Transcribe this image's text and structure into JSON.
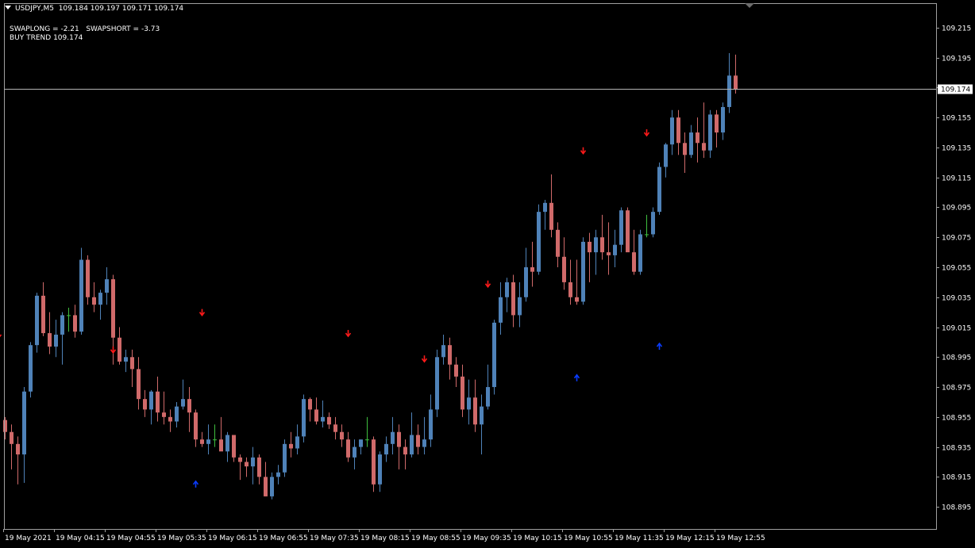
{
  "header": {
    "symbol": "USDJPY,M5",
    "ohlc": "109.184 109.197 109.171 109.174",
    "swap_text": "SWAPLONG = -2.21   SWAPSHORT = -3.73",
    "trend_text": "BUY TREND 109.174"
  },
  "colors": {
    "background": "#000000",
    "frame": "#a0a0a0",
    "bull": "#4f82b8",
    "bear": "#d06a6a",
    "doji": "#3fbf3f",
    "down_arrow": "#ff1a1a",
    "up_arrow": "#0a3cff",
    "text": "#ffffff"
  },
  "chart_data": {
    "type": "candlestick",
    "y_range": [
      108.885,
      109.225
    ],
    "yticks": [
      "109.215",
      "109.195",
      "109.175",
      "109.155",
      "109.135",
      "109.115",
      "109.095",
      "109.075",
      "109.055",
      "109.035",
      "109.015",
      "108.995",
      "108.975",
      "108.955",
      "108.935",
      "108.915",
      "108.895"
    ],
    "current_price": "109.174",
    "xticks": [
      "19 May 2021",
      "19 May 04:15",
      "19 May 04:55",
      "19 May 05:35",
      "19 May 06:15",
      "19 May 06:55",
      "19 May 07:35",
      "19 May 08:15",
      "19 May 08:55",
      "19 May 09:35",
      "19 May 10:15",
      "19 May 10:55",
      "19 May 11:35",
      "19 May 12:15",
      "19 May 12:55"
    ],
    "candles": [
      [
        108.953,
        108.955,
        108.94,
        108.945
      ],
      [
        108.945,
        108.95,
        108.92,
        108.937
      ],
      [
        108.937,
        108.942,
        108.91,
        108.93
      ],
      [
        108.93,
        108.975,
        108.911,
        108.972
      ],
      [
        108.972,
        109.005,
        108.968,
        109.003
      ],
      [
        109.003,
        109.038,
        108.998,
        109.036
      ],
      [
        109.036,
        109.045,
        109.009,
        109.011
      ],
      [
        109.011,
        109.025,
        108.997,
        109.002
      ],
      [
        109.002,
        109.02,
        108.995,
        109.01
      ],
      [
        109.01,
        109.025,
        108.99,
        109.023
      ],
      [
        109.023,
        109.028,
        109.012,
        109.023
      ],
      [
        109.023,
        109.03,
        109.008,
        109.012
      ],
      [
        109.012,
        109.068,
        109.01,
        109.06
      ],
      [
        109.06,
        109.063,
        109.03,
        109.035
      ],
      [
        109.035,
        109.045,
        109.025,
        109.03
      ],
      [
        109.03,
        109.04,
        109.02,
        109.038
      ],
      [
        109.038,
        109.055,
        109.03,
        109.047
      ],
      [
        109.047,
        109.05,
        108.99,
        109.008
      ],
      [
        109.008,
        109.015,
        108.99,
        108.992
      ],
      [
        108.992,
        109.0,
        108.985,
        108.995
      ],
      [
        108.995,
        109.0,
        108.975,
        108.987
      ],
      [
        108.987,
        108.995,
        108.96,
        108.967
      ],
      [
        108.967,
        108.973,
        108.955,
        108.96
      ],
      [
        108.96,
        108.973,
        108.95,
        108.972
      ],
      [
        108.972,
        108.982,
        108.952,
        108.958
      ],
      [
        108.958,
        108.972,
        108.95,
        108.955
      ],
      [
        108.955,
        108.96,
        108.945,
        108.952
      ],
      [
        108.952,
        108.965,
        108.948,
        108.962
      ],
      [
        108.962,
        108.98,
        108.96,
        108.967
      ],
      [
        108.967,
        108.975,
        108.945,
        108.958
      ],
      [
        108.958,
        108.96,
        108.935,
        108.94
      ],
      [
        108.94,
        108.945,
        108.935,
        108.937
      ],
      [
        108.937,
        108.95,
        108.93,
        108.94
      ],
      [
        108.94,
        108.95,
        108.935,
        108.94
      ],
      [
        108.94,
        108.955,
        108.935,
        108.932
      ],
      [
        108.932,
        108.945,
        108.925,
        108.943
      ],
      [
        108.943,
        108.943,
        108.925,
        108.928
      ],
      [
        108.928,
        108.93,
        108.913,
        108.925
      ],
      [
        108.925,
        108.928,
        108.915,
        108.922
      ],
      [
        108.922,
        108.935,
        108.91,
        108.928
      ],
      [
        108.928,
        108.93,
        108.91,
        108.915
      ],
      [
        108.915,
        108.925,
        108.902,
        108.902
      ],
      [
        108.902,
        108.918,
        108.9,
        108.915
      ],
      [
        108.915,
        108.923,
        108.91,
        108.918
      ],
      [
        108.918,
        108.94,
        108.915,
        108.937
      ],
      [
        108.937,
        108.945,
        108.928,
        108.934
      ],
      [
        108.934,
        108.95,
        108.93,
        108.942
      ],
      [
        108.942,
        108.97,
        108.938,
        108.967
      ],
      [
        108.967,
        108.968,
        108.952,
        108.96
      ],
      [
        108.96,
        108.968,
        108.95,
        108.952
      ],
      [
        108.952,
        108.966,
        108.948,
        108.955
      ],
      [
        108.955,
        108.958,
        108.947,
        108.95
      ],
      [
        108.95,
        108.955,
        108.94,
        108.945
      ],
      [
        108.945,
        108.95,
        108.935,
        108.94
      ],
      [
        108.94,
        108.945,
        108.925,
        108.928
      ],
      [
        108.928,
        108.94,
        108.92,
        108.935
      ],
      [
        108.935,
        108.94,
        108.93,
        108.94
      ],
      [
        108.94,
        108.955,
        108.935,
        108.94
      ],
      [
        108.94,
        108.942,
        108.905,
        108.91
      ],
      [
        108.91,
        108.932,
        108.905,
        108.93
      ],
      [
        108.93,
        108.942,
        108.925,
        108.937
      ],
      [
        108.937,
        108.955,
        108.93,
        108.945
      ],
      [
        108.945,
        108.95,
        108.92,
        108.935
      ],
      [
        108.935,
        108.94,
        108.92,
        108.93
      ],
      [
        108.93,
        108.958,
        108.928,
        108.943
      ],
      [
        108.943,
        108.95,
        108.93,
        108.935
      ],
      [
        108.935,
        108.955,
        108.93,
        108.94
      ],
      [
        108.94,
        108.97,
        108.935,
        108.96
      ],
      [
        108.96,
        109.0,
        108.955,
        108.995
      ],
      [
        108.995,
        109.01,
        108.99,
        109.003
      ],
      [
        109.003,
        109.008,
        108.98,
        108.99
      ],
      [
        108.99,
        108.995,
        108.975,
        108.982
      ],
      [
        108.982,
        108.99,
        108.955,
        108.96
      ],
      [
        108.96,
        108.98,
        108.95,
        108.968
      ],
      [
        108.968,
        108.98,
        108.945,
        108.95
      ],
      [
        108.95,
        108.97,
        108.93,
        108.962
      ],
      [
        108.962,
        108.99,
        108.96,
        108.975
      ],
      [
        108.975,
        109.02,
        108.97,
        109.018
      ],
      [
        109.018,
        109.045,
        109.01,
        109.035
      ],
      [
        109.035,
        109.048,
        109.025,
        109.045
      ],
      [
        109.045,
        109.05,
        109.015,
        109.023
      ],
      [
        109.023,
        109.045,
        109.015,
        109.035
      ],
      [
        109.035,
        109.068,
        109.032,
        109.055
      ],
      [
        109.055,
        109.072,
        109.042,
        109.052
      ],
      [
        109.052,
        109.097,
        109.05,
        109.092
      ],
      [
        109.092,
        109.1,
        109.08,
        109.098
      ],
      [
        109.098,
        109.117,
        109.075,
        109.08
      ],
      [
        109.08,
        109.085,
        109.055,
        109.062
      ],
      [
        109.062,
        109.075,
        109.04,
        109.045
      ],
      [
        109.045,
        109.06,
        109.03,
        109.035
      ],
      [
        109.035,
        109.06,
        109.03,
        109.032
      ],
      [
        109.032,
        109.075,
        109.03,
        109.072
      ],
      [
        109.072,
        109.078,
        109.045,
        109.065
      ],
      [
        109.065,
        109.08,
        109.05,
        109.075
      ],
      [
        109.075,
        109.09,
        109.06,
        109.065
      ],
      [
        109.065,
        109.085,
        109.05,
        109.063
      ],
      [
        109.063,
        109.08,
        109.055,
        109.07
      ],
      [
        109.07,
        109.095,
        109.065,
        109.093
      ],
      [
        109.093,
        109.095,
        109.07,
        109.065
      ],
      [
        109.065,
        109.08,
        109.05,
        109.052
      ],
      [
        109.052,
        109.08,
        109.05,
        109.077
      ],
      [
        109.077,
        109.09,
        109.075,
        109.077
      ],
      [
        109.077,
        109.095,
        109.075,
        109.092
      ],
      [
        109.092,
        109.125,
        109.09,
        109.122
      ],
      [
        109.122,
        109.138,
        109.115,
        109.137
      ],
      [
        109.137,
        109.16,
        109.13,
        109.155
      ],
      [
        109.155,
        109.16,
        109.13,
        109.138
      ],
      [
        109.138,
        109.145,
        109.118,
        109.13
      ],
      [
        109.13,
        109.15,
        109.128,
        109.145
      ],
      [
        109.145,
        109.155,
        109.125,
        109.138
      ],
      [
        109.138,
        109.165,
        109.128,
        109.133
      ],
      [
        109.133,
        109.16,
        109.128,
        109.157
      ],
      [
        109.157,
        109.16,
        109.135,
        109.145
      ],
      [
        109.145,
        109.165,
        109.14,
        109.162
      ],
      [
        109.162,
        109.198,
        109.158,
        109.183
      ],
      [
        109.183,
        109.197,
        109.171,
        109.174
      ]
    ],
    "down_arrows": [
      [
        -1,
        109.01
      ],
      [
        17,
        109.0
      ],
      [
        31,
        109.025
      ],
      [
        54,
        109.011
      ],
      [
        66,
        108.994
      ],
      [
        76,
        109.044
      ],
      [
        91,
        109.133
      ],
      [
        101,
        109.145
      ]
    ],
    "up_arrows": [
      [
        30,
        108.91
      ],
      [
        90,
        108.981
      ],
      [
        103,
        109.002
      ]
    ]
  }
}
